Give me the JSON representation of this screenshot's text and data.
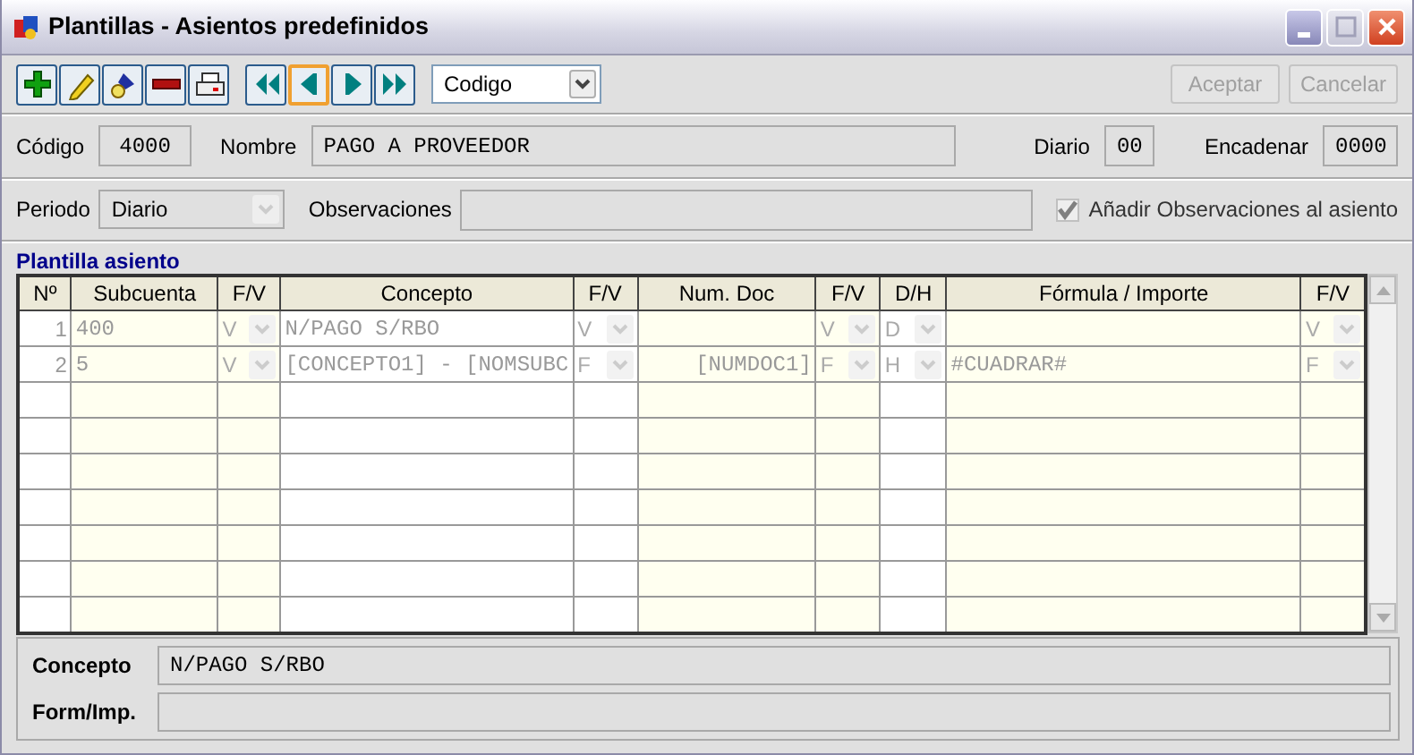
{
  "window": {
    "title": "Plantillas - Asientos predefinidos"
  },
  "toolbar": {
    "buttons": [
      {
        "kind": "add",
        "selected": false
      },
      {
        "kind": "edit",
        "selected": false
      },
      {
        "kind": "search",
        "selected": false
      },
      {
        "kind": "delete",
        "selected": false
      },
      {
        "kind": "print",
        "selected": false
      },
      {
        "kind": "first",
        "selected": false
      },
      {
        "kind": "prev",
        "selected": true
      },
      {
        "kind": "next",
        "selected": false
      },
      {
        "kind": "last",
        "selected": false
      }
    ],
    "sort_select": {
      "value": "Codigo"
    },
    "actions": [
      {
        "label": "Aceptar",
        "disabled": true
      },
      {
        "label": "Cancelar",
        "disabled": true
      }
    ]
  },
  "header": {
    "codigo": {
      "label": "Código",
      "value": "4000"
    },
    "nombre": {
      "label": "Nombre",
      "value": "PAGO A PROVEEDOR"
    },
    "diario": {
      "label": "Diario",
      "value": "00"
    },
    "encadenar": {
      "label": "Encadenar",
      "value": "0000"
    }
  },
  "options": {
    "periodo": {
      "label": "Periodo",
      "value": "Diario",
      "disabled": true
    },
    "observaciones": {
      "label": "Observaciones"
    },
    "add_observaciones": {
      "label": "Añadir Observaciones al asiento",
      "checked": true,
      "disabled": true
    }
  },
  "grid": {
    "title": "Plantilla asiento",
    "columns": [
      {
        "label": "Nº",
        "kind": "index",
        "shaded": false
      },
      {
        "label": "Subcuenta",
        "kind": "text",
        "shaded": true
      },
      {
        "label": "F/V",
        "kind": "combo",
        "shaded": true
      },
      {
        "label": "Concepto",
        "kind": "text",
        "shaded": false
      },
      {
        "label": "F/V",
        "kind": "combo",
        "shaded": false
      },
      {
        "label": "Num. Doc",
        "kind": "right",
        "shaded": true
      },
      {
        "label": "F/V",
        "kind": "combo",
        "shaded": true
      },
      {
        "label": "D/H",
        "kind": "combo",
        "shaded": false
      },
      {
        "label": "Fórmula / Importe",
        "kind": "text",
        "shaded": true
      },
      {
        "label": "F/V",
        "kind": "combo",
        "shaded": true
      }
    ],
    "rows": [
      [
        "1",
        "400",
        "V",
        "N/PAGO S/RBO",
        "V",
        null,
        "V",
        "D",
        null,
        "V"
      ],
      [
        "2",
        "5",
        "V",
        "[CONCEPTO1] - [NOMSUBC",
        "F",
        "[NUMDOC1]",
        "F",
        "H",
        "#CUADRAR#",
        "F"
      ]
    ]
  },
  "detail": {
    "concepto": {
      "label": "Concepto",
      "value": "N/PAGO S/RBO"
    },
    "formula": {
      "label": "Form/Imp."
    }
  }
}
